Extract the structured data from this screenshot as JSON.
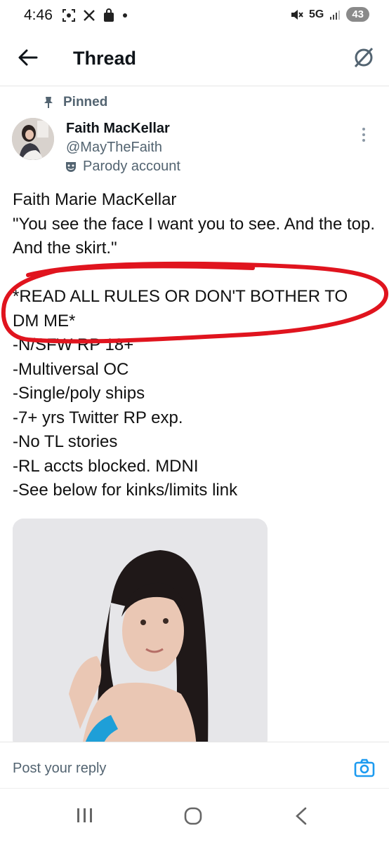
{
  "status": {
    "time": "4:46",
    "network": "5G",
    "battery": "43"
  },
  "header": {
    "title": "Thread"
  },
  "post": {
    "pinned_label": "Pinned",
    "display_name": "Faith MacKellar",
    "handle": "@MayTheFaith",
    "parody_label": "Parody account",
    "lines": [
      "Faith Marie MacKellar",
      "\"You see the face I want you to see. And the top. And the skirt.\"",
      "",
      "*READ ALL RULES OR DON'T BOTHER TO DM ME*",
      "-N/SFW RP 18+",
      "-Multiversal OC",
      "-Single/poly ships",
      "-7+ yrs Twitter RP exp.",
      "-No TL stories",
      "-RL accts blocked. MDNI",
      "-See below for kinks/limits link"
    ]
  },
  "reply": {
    "placeholder": "Post your reply"
  },
  "colors": {
    "accent": "#1d9bf0",
    "annotation": "#e0141e",
    "muted": "#536471"
  }
}
